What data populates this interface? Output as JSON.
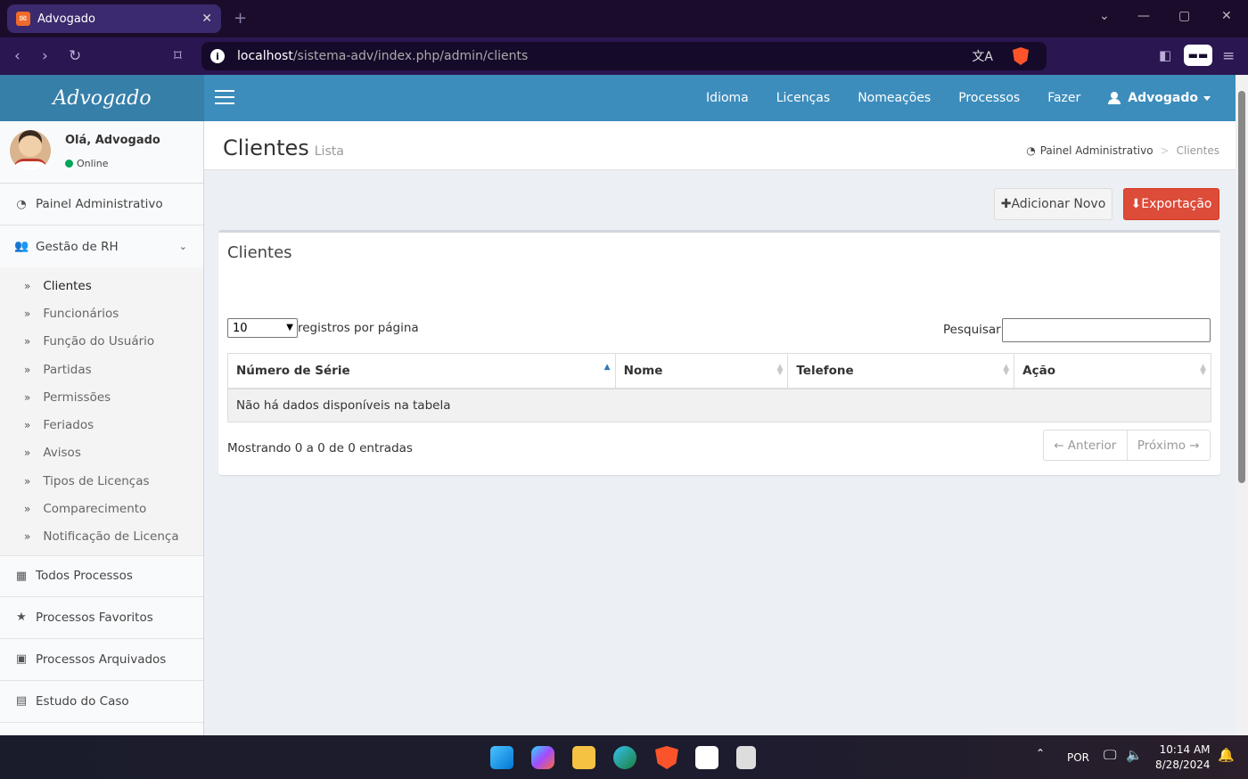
{
  "browser": {
    "tab_title": "Advogado",
    "tab_favicon": "xampp-icon",
    "url_host": "localhost",
    "url_path": "/sistema-adv/index.php/admin/clients"
  },
  "app": {
    "logo": "Advogado",
    "topnav": [
      "Idioma",
      "Licenças",
      "Nomeações",
      "Processos",
      "Fazer"
    ],
    "user_menu": "Advogado"
  },
  "sidebar": {
    "greeting": "Olá, Advogado",
    "status": "Online",
    "dashboard": "Painel Administrativo",
    "hr_group": "Gestão de RH",
    "hr_items": [
      "Clientes",
      "Funcionários",
      "Função do Usuário",
      "Partidas",
      "Permissões",
      "Feriados",
      "Avisos",
      "Tipos de Licenças",
      "Comparecimento",
      "Notificação de Licença"
    ],
    "all_cases": "Todos Processos",
    "fav_cases": "Processos Favoritos",
    "archived_cases": "Processos Arquivados",
    "case_study": "Estudo do Caso"
  },
  "page": {
    "title": "Clientes",
    "subtitle": "Lista",
    "breadcrumb_home": "Painel Administrativo",
    "breadcrumb_current": "Clientes",
    "add_button": "Adicionar Novo",
    "export_button": "Exportação"
  },
  "table": {
    "box_title": "Clientes",
    "page_length": "10",
    "length_label": "registros por página",
    "search_label": "Pesquisar:",
    "columns": [
      "Número de Série",
      "Nome",
      "Telefone",
      "Ação"
    ],
    "empty_text": "Não há dados disponíveis na tabela",
    "info": "Mostrando 0 a 0 de 0 entradas",
    "prev": "← Anterior",
    "next": "Próximo →"
  },
  "taskbar": {
    "language": "POR",
    "time": "10:14 AM",
    "date": "8/28/2024"
  },
  "colors": {
    "header": "#3c8dbc",
    "logo_bg": "#367fa9",
    "export_btn": "#dd4b39"
  }
}
